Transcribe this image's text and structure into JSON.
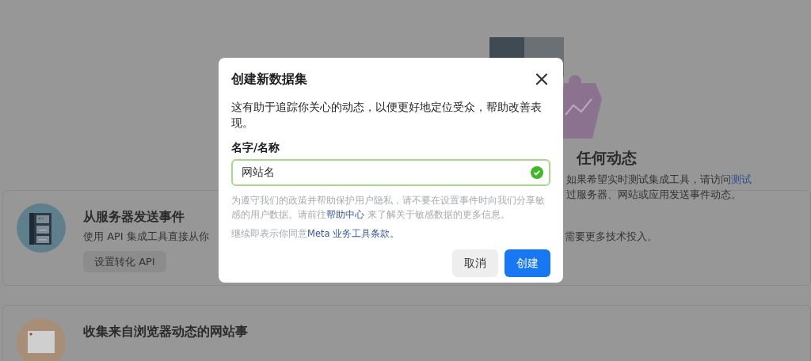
{
  "background": {
    "empty_state": {
      "title": "任何动态",
      "line_1": "如果希望实时测试集成工具，请访问",
      "link": "测试",
      "line_2": "过服务器、网站或应用发送事件动态。"
    },
    "cards": [
      {
        "kind": "server",
        "title": "从服务器发送事件",
        "description": "使用 API 集成工具直接从你",
        "description_end": "需要更多技术投入。",
        "button": "设置转化 API"
      },
      {
        "kind": "browser",
        "title": "收集来自浏览器动态的网站事"
      }
    ]
  },
  "dialog": {
    "title": "创建新数据集",
    "description": "这有助于追踪你关心的动态，以便更好地定位受众，帮助改善表现。",
    "field": {
      "label": "名字/名称",
      "value": "网站名",
      "valid": true
    },
    "hint_before": "为遵守我们的政策并帮助保护用户隐私，请不要在设置事件时向我们分享敏感的用户数据。请前往",
    "hint_link": "帮助中心",
    "hint_after": " 来了解关于敏感数据的更多信息。",
    "terms_before": "继续即表示你同意",
    "terms_link": "Meta 业务工具条款。",
    "buttons": [
      {
        "label": "取消",
        "kind": "secondary"
      },
      {
        "label": "创建",
        "kind": "primary"
      }
    ]
  }
}
